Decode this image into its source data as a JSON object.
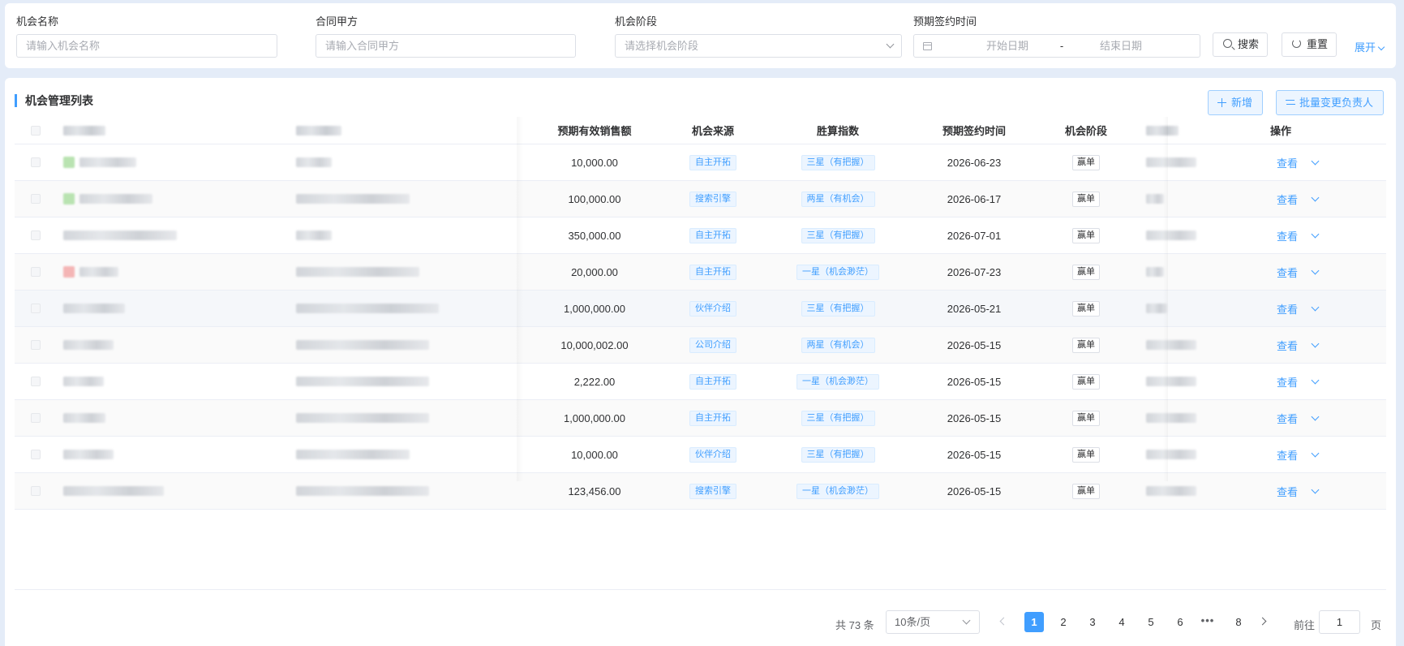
{
  "filters": {
    "name": {
      "label": "机会名称",
      "placeholder": "请输入机会名称"
    },
    "party": {
      "label": "合同甲方",
      "placeholder": "请输入合同甲方"
    },
    "stage": {
      "label": "机会阶段",
      "placeholder": "请选择机会阶段"
    },
    "sign_time": {
      "label": "预期签约时间",
      "start_placeholder": "开始日期",
      "separator": "-",
      "end_placeholder": "结束日期"
    },
    "search_label": "搜索",
    "reset_label": "重置",
    "expand_label": "展开"
  },
  "list": {
    "title": "机会管理列表",
    "add_label": "新增",
    "batch_label": "批量变更负责人",
    "columns": {
      "amount": "预期有效销售额",
      "source": "机会来源",
      "win_index": "胜算指数",
      "sign_date": "预期签约时间",
      "stage": "机会阶段",
      "action": "操作"
    },
    "rows": [
      {
        "amount": "10,000.00",
        "source": "自主开拓",
        "win": "三星（有把握）",
        "date": "2026-06-23",
        "stage": "赢单",
        "action": "查看"
      },
      {
        "amount": "100,000.00",
        "source": "搜索引擎",
        "win": "两星（有机会）",
        "date": "2026-06-17",
        "stage": "赢单",
        "action": "查看"
      },
      {
        "amount": "350,000.00",
        "source": "自主开拓",
        "win": "三星（有把握）",
        "date": "2026-07-01",
        "stage": "赢单",
        "action": "查看"
      },
      {
        "amount": "20,000.00",
        "source": "自主开拓",
        "win": "一星（机会渺茫）",
        "date": "2026-07-23",
        "stage": "赢单",
        "action": "查看"
      },
      {
        "amount": "1,000,000.00",
        "source": "伙伴介绍",
        "win": "三星（有把握）",
        "date": "2026-05-21",
        "stage": "赢单",
        "action": "查看"
      },
      {
        "amount": "10,000,002.00",
        "source": "公司介绍",
        "win": "两星（有机会）",
        "date": "2026-05-15",
        "stage": "赢单",
        "action": "查看"
      },
      {
        "amount": "2,222.00",
        "source": "自主开拓",
        "win": "一星（机会渺茫）",
        "date": "2026-05-15",
        "stage": "赢单",
        "action": "查看"
      },
      {
        "amount": "1,000,000.00",
        "source": "自主开拓",
        "win": "三星（有把握）",
        "date": "2026-05-15",
        "stage": "赢单",
        "action": "查看"
      },
      {
        "amount": "10,000.00",
        "source": "伙伴介绍",
        "win": "三星（有把握）",
        "date": "2026-05-15",
        "stage": "赢单",
        "action": "查看"
      },
      {
        "amount": "123,456.00",
        "source": "搜索引擎",
        "win": "一星（机会渺茫）",
        "date": "2026-05-15",
        "stage": "赢单",
        "action": "查看"
      }
    ]
  },
  "pagination": {
    "total_text": "共 73 条",
    "page_size": "10条/页",
    "pages": [
      "1",
      "2",
      "3",
      "4",
      "5",
      "6",
      "8"
    ],
    "current": "1",
    "more": "•••",
    "goto_label": "前往",
    "goto_value": "1",
    "goto_suffix": "页"
  },
  "colors": {
    "accent": "#409eff",
    "background": "#e4ecf8"
  }
}
